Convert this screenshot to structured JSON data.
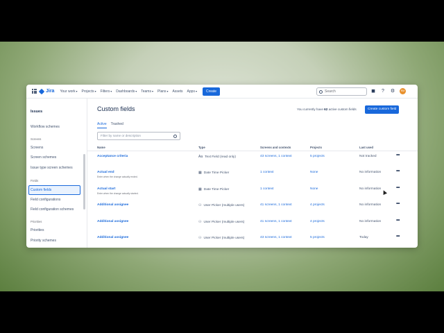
{
  "topnav": {
    "app_name": "Jira",
    "items": [
      "Your work",
      "Projects",
      "Filters",
      "Dashboards",
      "Teams",
      "Plans",
      "Assets",
      "Apps"
    ],
    "dropdown_items": [
      true,
      true,
      true,
      true,
      true,
      true,
      false,
      true
    ],
    "create_label": "Create",
    "search_placeholder": "Search",
    "avatar_initials": "RM"
  },
  "sidebar": {
    "title": "Issues",
    "entries": [
      {
        "kind": "item",
        "label": "Workflow schemes"
      },
      {
        "kind": "group",
        "label": "Screens"
      },
      {
        "kind": "item",
        "label": "Screens"
      },
      {
        "kind": "item",
        "label": "Screen schemes"
      },
      {
        "kind": "item",
        "label": "Issue type screen schemes"
      },
      {
        "kind": "group",
        "label": "Fields"
      },
      {
        "kind": "active",
        "label": "Custom fields"
      },
      {
        "kind": "item",
        "label": "Field configurations"
      },
      {
        "kind": "item",
        "label": "Field configuration schemes"
      },
      {
        "kind": "group",
        "label": "Priorities"
      },
      {
        "kind": "item",
        "label": "Priorities"
      },
      {
        "kind": "item",
        "label": "Priority schemes"
      }
    ]
  },
  "main": {
    "title": "Custom fields",
    "active_count_prefix": "You currently have",
    "active_count": "62",
    "active_count_suffix": "active custom fields",
    "create_button": "Create custom field",
    "tabs": [
      "Active",
      "Trashed"
    ],
    "filter_placeholder": "Filter by name or description",
    "columns": [
      "Name",
      "Type",
      "Screens and contexts",
      "Projects",
      "Last used"
    ],
    "rows": [
      {
        "name": "Acceptance criteria",
        "desc": "",
        "type_icon": "text-field-icon",
        "type": "Text Field (read only)",
        "screens": "43 screens,  1 context",
        "projects": "5 projects",
        "last": "Not tracked"
      },
      {
        "name": "Actual end",
        "desc": "Enter when the change actually ended.",
        "type_icon": "calendar-icon",
        "type": "Date Time Picker",
        "screens": "1 context",
        "projects": "None",
        "last": "No information"
      },
      {
        "name": "Actual start",
        "desc": "Enter when the change actually started.",
        "type_icon": "calendar-icon",
        "type": "Date Time Picker",
        "screens": "1 context",
        "projects": "None",
        "last": "No information"
      },
      {
        "name": "Additional assignee",
        "desc": "",
        "type_icon": "users-icon",
        "type": "User Picker (multiple users)",
        "screens": "41 screens,  1 context",
        "projects": "4 projects",
        "last": "No information"
      },
      {
        "name": "Additional assignee",
        "desc": "",
        "type_icon": "users-icon",
        "type": "User Picker (multiple users)",
        "screens": "41 screens,  1 context",
        "projects": "4 projects",
        "last": "No information"
      },
      {
        "name": "Additional assignee",
        "desc": "",
        "type_icon": "users-icon",
        "type": "User Picker (multiple users)",
        "screens": "43 screens,  1 context",
        "projects": "5 projects",
        "last": "Today"
      }
    ]
  }
}
